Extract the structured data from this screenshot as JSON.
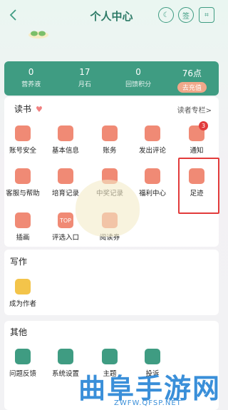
{
  "header": {
    "title": "个人中心",
    "sign_label": "签"
  },
  "stats": [
    {
      "value": "0",
      "label": "营养液"
    },
    {
      "value": "17",
      "label": "月石"
    },
    {
      "value": "0",
      "label": "回馈积分"
    },
    {
      "value": "76点",
      "label": "去充值"
    }
  ],
  "reading": {
    "title": "读书",
    "link": "读者专栏>",
    "items": [
      {
        "label": "账号安全",
        "icon": "lock-icon",
        "color": "#f08a75"
      },
      {
        "label": "基本信息",
        "icon": "person-icon",
        "color": "#f08a75"
      },
      {
        "label": "账务",
        "icon": "money-bag-icon",
        "color": "#f08a75"
      },
      {
        "label": "发出评论",
        "icon": "mail-icon",
        "color": "#f08a75"
      },
      {
        "label": "通知",
        "icon": "bell-icon",
        "color": "#f08a75",
        "badge": "3"
      },
      {
        "label": "客服与帮助",
        "icon": "help-icon",
        "color": "#f08a75"
      },
      {
        "label": "培育记录",
        "icon": "sprout-icon",
        "color": "#f08a75"
      },
      {
        "label": "中奖记录",
        "icon": "gift-icon",
        "color": "#f08a75"
      },
      {
        "label": "福利中心",
        "icon": "coin-icon",
        "color": "#f08a75"
      },
      {
        "label": "足迹",
        "icon": "footprint-icon",
        "color": "#f08a75"
      },
      {
        "label": "插画",
        "icon": "picture-icon",
        "color": "#f08a75"
      },
      {
        "label": "评选入口",
        "icon": "top-icon",
        "color": "#f08a75",
        "icon_text": "TOP"
      },
      {
        "label": "阅读券",
        "icon": "ticket-icon",
        "color": "#f08a75"
      }
    ]
  },
  "writing": {
    "title": "写作",
    "items": [
      {
        "label": "成为作者",
        "icon": "pen-icon",
        "color": "#f3c44a"
      }
    ]
  },
  "other": {
    "title": "其他",
    "items": [
      {
        "label": "问题反馈",
        "icon": "question-icon",
        "color": "#3f9c82"
      },
      {
        "label": "系统设置",
        "icon": "gear-icon",
        "color": "#3f9c82"
      },
      {
        "label": "主题",
        "icon": "shirt-icon",
        "color": "#3f9c82"
      },
      {
        "label": "投诉",
        "icon": "shield-icon",
        "color": "#3f9c82"
      }
    ]
  },
  "watermark": {
    "main": "曲阜手游网",
    "sub": "ZWFW.QFSP.NET"
  }
}
